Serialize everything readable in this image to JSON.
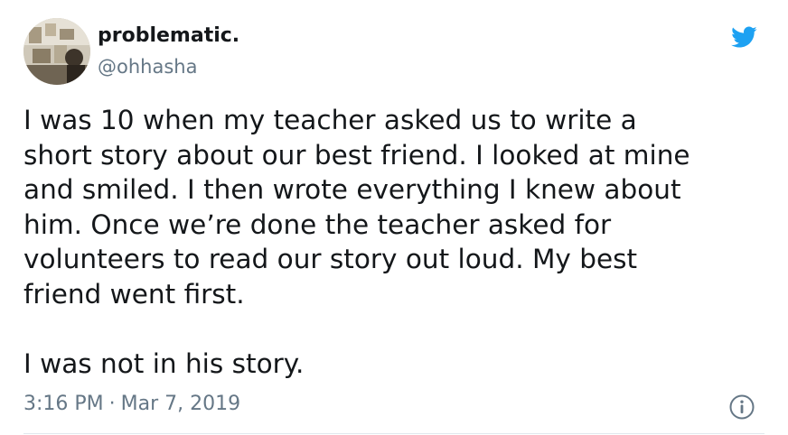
{
  "author": {
    "display_name": "problematic.",
    "handle": "@ohhasha"
  },
  "tweet": {
    "paragraph_1": "I was 10 when my teacher asked us to write a\nshort story about our best friend. I looked at mine\nand smiled. I then wrote everything I knew about\nhim. Once we’re done the teacher asked for\nvolunteers to read our story out loud. My best\nfriend went first.",
    "paragraph_2": "I was not in his story."
  },
  "meta": {
    "time": "3:16 PM",
    "separator": "·",
    "date": "Mar 7, 2019"
  },
  "icons": {
    "logo": "twitter-bird-icon",
    "info": "info-icon"
  },
  "colors": {
    "brand": "#1da1f2",
    "text": "#14171a",
    "secondary": "#657786"
  }
}
